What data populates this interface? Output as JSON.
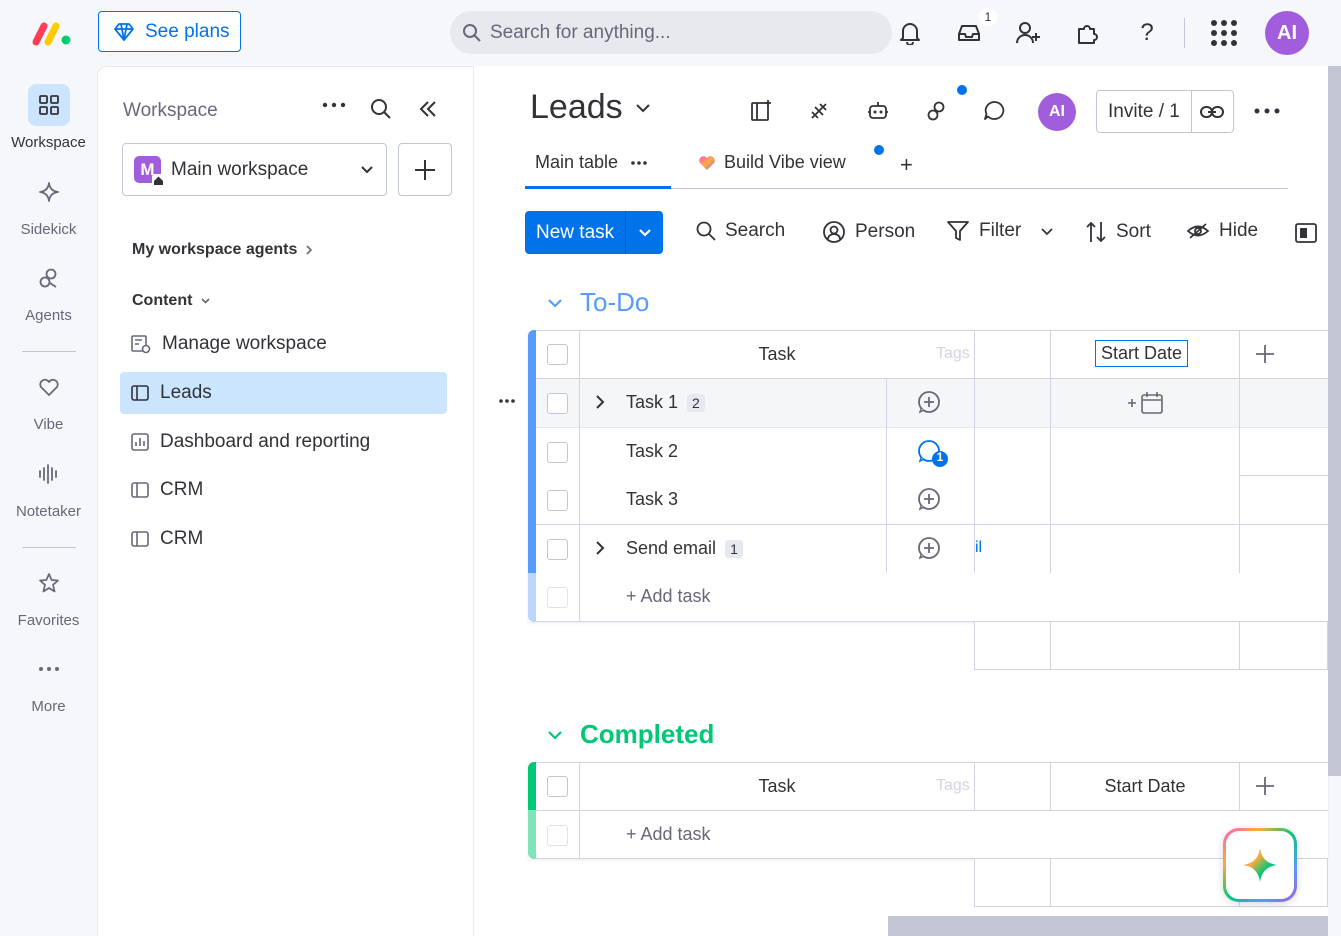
{
  "topbar": {
    "see_plans": "See plans",
    "search_placeholder": "Search for anything...",
    "inbox_badge": "1",
    "avatar_initials": "AI"
  },
  "rail": {
    "items": [
      {
        "label": "Workspace",
        "icon": "grid-icon"
      },
      {
        "label": "Sidekick",
        "icon": "sparkle-icon"
      },
      {
        "label": "Agents",
        "icon": "agent-icon"
      },
      {
        "label": "Vibe",
        "icon": "heart-icon"
      },
      {
        "label": "Notetaker",
        "icon": "waveform-icon"
      },
      {
        "label": "Favorites",
        "icon": "star-icon"
      },
      {
        "label": "More",
        "icon": "more-dots-icon"
      }
    ]
  },
  "workspace": {
    "title": "Workspace",
    "selected": "Main workspace",
    "selected_initial": "M",
    "agents_section": "My workspace agents",
    "content_section": "Content",
    "items": [
      {
        "label": "Manage workspace"
      },
      {
        "label": "Leads"
      },
      {
        "label": "Dashboard and reporting"
      },
      {
        "label": "CRM"
      },
      {
        "label": "CRM"
      }
    ]
  },
  "board": {
    "title": "Leads",
    "invite": "Invite / 1",
    "avatar_initials": "AI",
    "tabs": {
      "main": "Main table",
      "vibe": "Build Vibe view",
      "add": "+"
    },
    "toolbar": {
      "new_task": "New task",
      "search": "Search",
      "person": "Person",
      "filter": "Filter",
      "sort": "Sort",
      "hide": "Hide"
    }
  },
  "groups": {
    "todo": {
      "title": "To-Do",
      "color": "#579bfc",
      "col_task": "Task",
      "col_tags_ghost": "Tags",
      "col_start": "Start Date",
      "rows": [
        {
          "name": "Task 1",
          "count": "2"
        },
        {
          "name": "Task 2",
          "updates": "1"
        },
        {
          "name": "Task 3"
        },
        {
          "name": "Send email",
          "count": "1",
          "clipped_text": "il"
        }
      ],
      "add_task": "+ Add task"
    },
    "completed": {
      "title": "Completed",
      "color": "#00c875",
      "col_task": "Task",
      "col_tags_ghost": "Tags",
      "col_start": "Start Date",
      "add_task": "+ Add task"
    }
  }
}
